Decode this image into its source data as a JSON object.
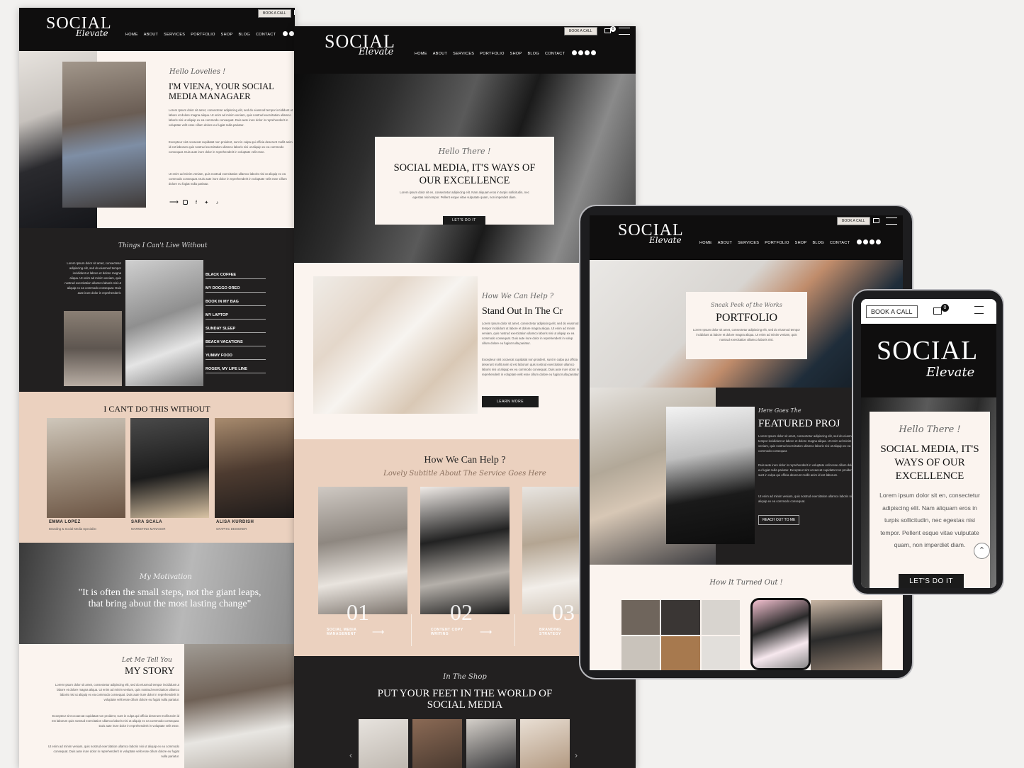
{
  "brand": {
    "name": "SOCIAL",
    "script": "Elevate"
  },
  "nav": [
    "HOME",
    "ABOUT",
    "SERVICES",
    "PORTFOLIO",
    "SHOP",
    "BLOG",
    "CONTACT"
  ],
  "book_call": "BOOK A CALL",
  "cart_count": "0",
  "page_left": {
    "hero_script": "Hello Lovelies !",
    "hero_title": "I'M VIENA, YOUR SOCIAL MEDIA MANAGAER",
    "hero_p1": "Lorem Ipsum dolor sit amet, consectetur adipiscing elit, sed do eiusmod tempor incididunt ut labore et dolore magna aliqua. Ut enim ad minim veniam, quis nostrud exercitation ullamco laboris nisi ut aliquip ex ea commodo consequat. Duis aute irure dolor in reprehenderit in voluptate velit esse cillum dolore eu fugiat nulla pariatur.",
    "hero_p2": "Excepteur sint occaecat cupidatat non proident, sunt in culpa qui officia deserunt mollit anim id est laborum quis nostrud exercitation ullamco laboris nisi ut aliquip ex ea commodo consequat. Duis aute irure dolor in reprehenderit in voluptate velit esse.",
    "hero_p3": "Ut enim ad minim veniam, quis nostrud exercitation ullamco laboris nisi ut aliquip ex ea commodo consequat. Duis aute irure dolor in reprehenderit in voluptate velit esse cillum dolore eu fugiat nulla pariatur.",
    "things_script": "Things I Can't Live Without",
    "things_p": "Lorem Ipsum dolor sit amet, consectetur adipiscing elit, sed do eiusmod tempor incididunt ut labore et dolore magna aliqua. Ut enim ad minim veniam, quis nostrud exercitation ullamco laboris nisi ut aliquip ex ea commodo consequat. Duis aute irure dolor in reprehenderit.",
    "things": [
      "BLACK COFFEE",
      "MY DOGGO OREO",
      "BOOK IN MY BAG",
      "MY LAPTOP",
      "SUNDAY SLEEP",
      "BEACH VACATIONS",
      "YUMMY FOOD",
      "ROGER, MY LIFE LINE"
    ],
    "team_title": "I CAN'T DO THIS WITHOUT",
    "team": [
      {
        "name": "EMMA LOPEZ",
        "role": "Branding & Social Media Specialist"
      },
      {
        "name": "SARA SCALA",
        "role": "MARKETING MANAGER"
      },
      {
        "name": "ALISA KURDISH",
        "role": "GRAPHIC DESIGNER"
      }
    ],
    "motivation_script": "My Motivation",
    "quote": "\"It is often the small steps, not the giant leaps, that bring about the most lasting change\"",
    "story_script": "Let Me Tell You",
    "story_title": "MY STORY",
    "story_p1": "Lorem Ipsum dolor sit amet, consectetur adipiscing elit, sed do eiusmod tempor incididunt ut labore et dolore magna aliqua. Ut enim ad minim veniam, quis nostrud exercitation ullamco laboris nisi ut aliquip ex ea commodo consequat. Duis aute irure dolor in reprehenderit in voluptate velit esse cillum dolore eu fugiat nulla pariatur.",
    "story_p2": "Excepteur sint occaecat cupidatat non proident, sunt in culpa qui officia deserunt mollit anim id est laborum quis nostrud exercitation ullamco laboris nisi ut aliquip ex ea commodo consequat. Duis aute irure dolor in reprehenderit in voluptate velit esse.",
    "story_p3": "Ut enim ad minim veniam, quis nostrud exercitation ullamco laboris nisi ut aliquip ex ea commodo consequat. Duis aute irure dolor in reprehenderit in voluptate velit esse cillum dolore eu fugiat nulla pariatur."
  },
  "page_mid": {
    "hero_script": "Hello There !",
    "hero_title": "SOCIAL MEDIA, IT'S WAYS OF OUR EXCELLENCE",
    "hero_p": "Lorem ipsum dolor sit en, consectetur adipiscing elit. Nam aliquam eros in turpis sollicitudin, nec egestas nisi tempor. Pellent esque vitae vulputate quam, non imperdiet diam.",
    "hero_btn": "LET'S DO IT",
    "help_script": "How We Can Help ?",
    "help_title": "Stand Out In The Cr",
    "help_p1": "Lorem Ipsum dolor sit amet, consectetur adipiscing elit, sed do eiusmod tempor incididunt ut labore et dolore magna aliqua. Ut enim ad minim veniam, quis nostrud exercitation ullamco laboris nisi ut aliquip ex ea commodo consequat. Duis aute irure dolor in reprehenderit in volup cillum dolore eu fugiat nulla pariatur.",
    "help_p2": "Excepteur sint occaecat cupidatat non proident, sunt in culpa qui officia deserunt mollit anim id est laborum quis nostrud exercitation ullamco laboris nisi ut aliquip ex ea commodo consequat. Duis aute irure dolor in reprehenderit in voluptate velit esse cillum dolore eu fugiat nulla pariatur.",
    "help_btn": "LEARN MORE",
    "services_title": "How We Can Help ?",
    "services_script": "Lovely Subtitle About The Service Goes Here",
    "services": [
      {
        "num": "01",
        "label": "SOCIAL MEDIA MANAGEMENT"
      },
      {
        "num": "02",
        "label": "CONTENT COPY WRITING"
      },
      {
        "num": "03",
        "label": "BRANDING STRATEGY"
      }
    ],
    "shop_script": "In The Shop",
    "shop_title": "PUT YOUR FEET IN THE WORLD OF SOCIAL MEDIA"
  },
  "tablet": {
    "portfolio_script": "Sneak Peek of the Works",
    "portfolio_title": "PORTFOLIO",
    "portfolio_p": "Lorem Ipsum dolor sit amet, consectetur adipiscing elit, sed do eiusmod tempor incididunt ut labore et dolore magna aliqua. Ut enim ad minim veniam, quis nostrud exercitation ullamco laboris nisi.",
    "featured_script": "Here Goes The",
    "featured_title": "FEATURED PROJ",
    "featured_p1": "Lorem Ipsum dolor sit amet, consectetur adipiscing elit, sed do eiusmod tempor incididunt ut labore et dolore magna aliqua. Ut enim ad minim veniam, quis nostrud exercitation ullamco laboris nisi ut aliquip ex ea commodo consequat.",
    "featured_p2": "Duis aute irure dolor in reprehenderit in voluptate velit esse cillum dolore eu fugiat nulla pariatur. Excepteur sint occaecat cupidatat non proident, sunt in culpa qui officia deserunt mollit anim id est laborum.",
    "featured_p3": "Ut enim ad minim veniam, quis nostrud exercitation ullamco laboris nisi ut aliquip ex ea commodo consequat.",
    "featured_btn": "REACH OUT TO ME",
    "turned_script": "How It Turned Out !"
  },
  "phone": {
    "hero_script": "Hello There !",
    "hero_title": "SOCIAL MEDIA, IT'S WAYS OF OUR EXCELLENCE",
    "hero_p": "Lorem ipsum dolor sit en, consectetur adipiscing elit. Nam aliquam eros in turpis sollicitudin, nec egestas nisi tempor. Pellent esque vitae vulputate quam, non imperdiet diam.",
    "hero_btn": "LET'S DO IT"
  },
  "colors": {
    "black": "#0f0e0e",
    "cream": "#fbf4ef",
    "peach": "#ebd1bf",
    "charcoal": "#222020"
  }
}
